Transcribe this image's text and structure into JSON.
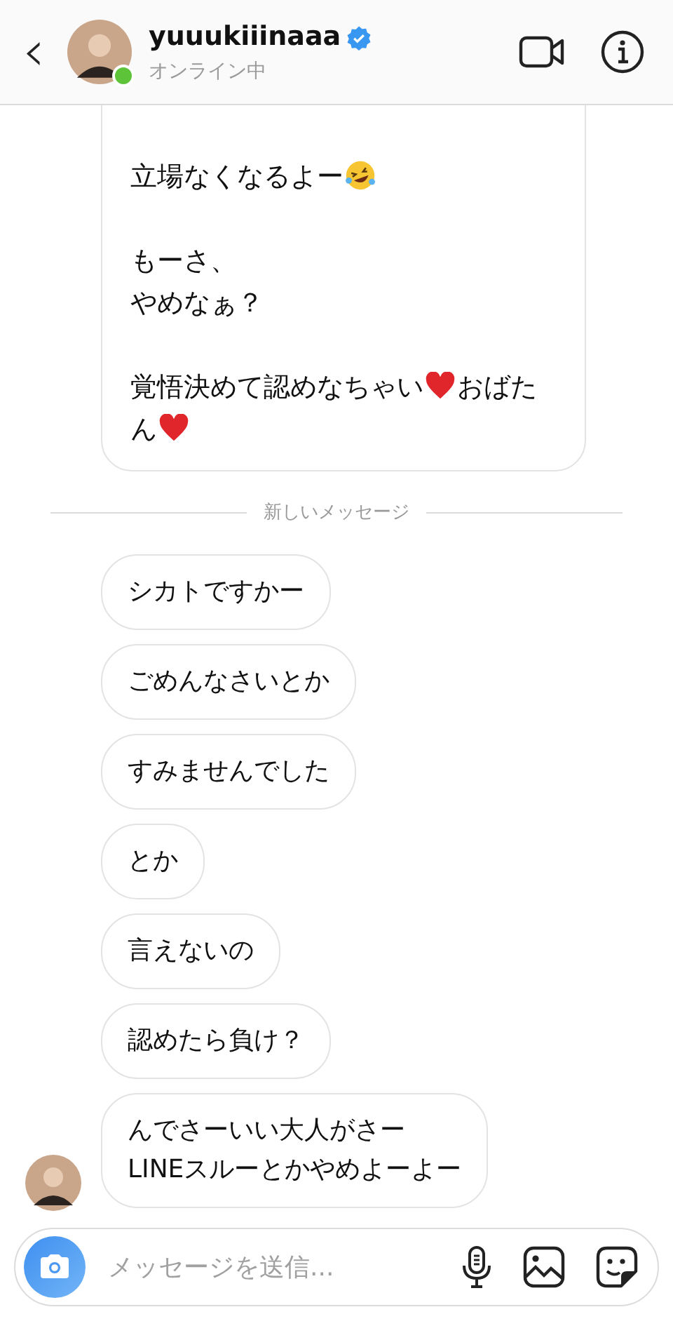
{
  "header": {
    "back": "‹",
    "username": "yuuukiiinaaa",
    "verified": true,
    "status": "オンライン中",
    "online": true
  },
  "top_message": {
    "paragraphs": [
      [
        [
          {
            "kind": "text",
            "text": "立場なくなるよー"
          },
          {
            "kind": "laughing"
          }
        ]
      ],
      [
        [
          {
            "kind": "text",
            "text": "もーさ、"
          }
        ],
        [
          {
            "kind": "text",
            "text": "やめなぁ？"
          }
        ]
      ],
      [
        [
          {
            "kind": "text",
            "text": "覚悟決めて認めなちゃい"
          },
          {
            "kind": "heart"
          },
          {
            "kind": "text",
            "text": "おばたん"
          },
          {
            "kind": "heart"
          }
        ]
      ]
    ]
  },
  "divider": "新しいメッセージ",
  "messages": [
    {
      "lines": [
        "シカトですかー"
      ],
      "avatar": false
    },
    {
      "lines": [
        "ごめんなさいとか"
      ],
      "avatar": false
    },
    {
      "lines": [
        "すみませんでした"
      ],
      "avatar": false
    },
    {
      "lines": [
        "とか"
      ],
      "avatar": false
    },
    {
      "lines": [
        "言えないの"
      ],
      "avatar": false
    },
    {
      "lines": [
        "認めたら負け？"
      ],
      "avatar": false
    },
    {
      "lines": [
        "んでさーいい大人がさー",
        "LINEスルーとかやめよーよー"
      ],
      "avatar": true
    }
  ],
  "composer": {
    "placeholder": "メッセージを送信..."
  }
}
